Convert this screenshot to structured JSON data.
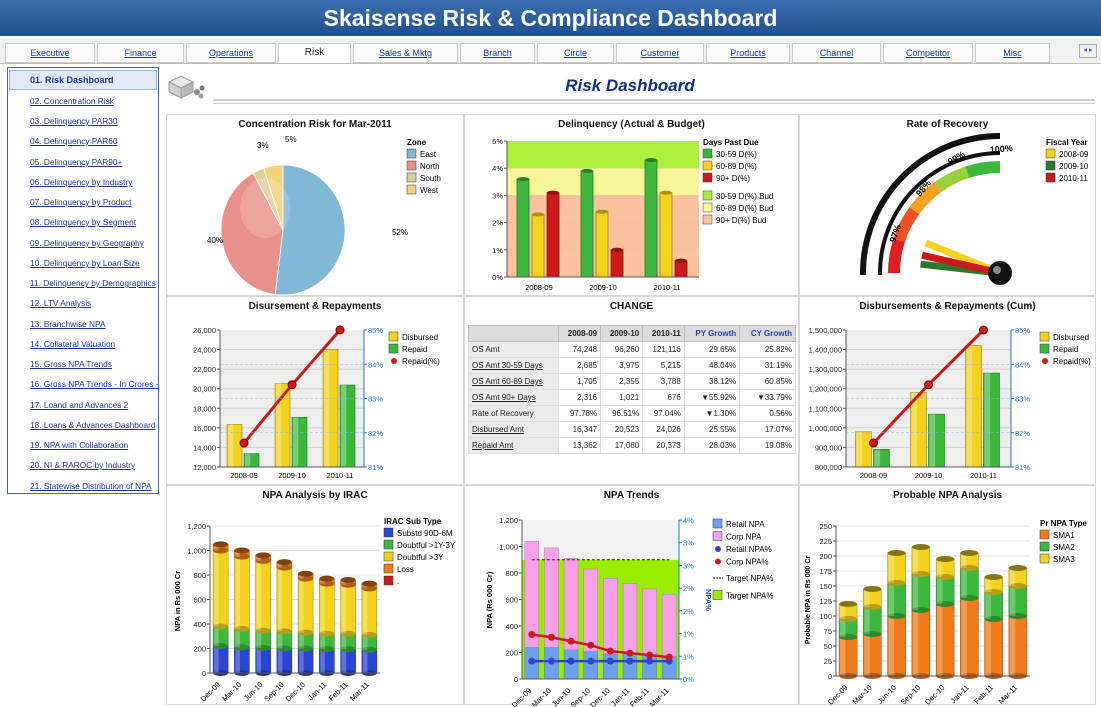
{
  "title": "Skaisense Risk & Compliance Dashboard",
  "tabs": [
    {
      "label": "Executive"
    },
    {
      "label": "Finance"
    },
    {
      "label": "Operations"
    },
    {
      "label": "Risk"
    },
    {
      "label": "Sales & Mktg"
    },
    {
      "label": "Branch"
    },
    {
      "label": "Circle"
    },
    {
      "label": "Customer"
    },
    {
      "label": "Products"
    },
    {
      "label": "Channel"
    },
    {
      "label": "Competitor"
    },
    {
      "label": "Misc"
    }
  ],
  "tab_nav_label": "◂ ▸",
  "sidebar": {
    "items": [
      {
        "label": "01. Risk Dashboard"
      },
      {
        "label": "02. Concentration Risk"
      },
      {
        "label": "03. Delinquency PAR30"
      },
      {
        "label": "04. Delinquency PAR60"
      },
      {
        "label": "05. Delinquency PAR90+"
      },
      {
        "label": "06. Delinquency by Industry"
      },
      {
        "label": "07. Delinquency by Product"
      },
      {
        "label": "08. Delinquency by Segment"
      },
      {
        "label": "09. Delinquency by Geography"
      },
      {
        "label": "10. Delinquency by Loan Size"
      },
      {
        "label": "11. Delinquency by Demographics"
      },
      {
        "label": "12. LTV Analysis"
      },
      {
        "label": "13. Branchwise NPA"
      },
      {
        "label": "14. Collateral Valuation"
      },
      {
        "label": "15. Gross NPA Trends"
      },
      {
        "label": "16. Gross NPA Trends - In Crores -"
      },
      {
        "label": "17. Loand and Advances 2"
      },
      {
        "label": "18. Loans & Advances Dashboard"
      },
      {
        "label": "19. NPA with Collaboration"
      },
      {
        "label": "20. NI & RAROC by Industry"
      },
      {
        "label": "21. Statewise Distribution of NPA"
      }
    ]
  },
  "page_title": "Risk Dashboard",
  "panels": {
    "concentration": {
      "title": "Concentration Risk for Mar-2011",
      "legend_title": "Zone"
    },
    "delinquency": {
      "title": "Delinquency (Actual & Budget)",
      "legend_title": "Days Past Due"
    },
    "recovery": {
      "title": "Rate of Recovery",
      "legend_title": "Fiscal Year"
    },
    "disbursement": {
      "title": "Disursement & Repayments"
    },
    "change": {
      "title": "CHANGE"
    },
    "disb_cum": {
      "title": "Disbursements & Repayments (Cum)"
    },
    "npa_irac": {
      "title": "NPA Analysis by IRAC",
      "legend_title": "IRAC Sub Type"
    },
    "npa_trends": {
      "title": "NPA Trends"
    },
    "probable_npa": {
      "title": "Probable NPA Analysis",
      "legend_title": "Pr NPA Type"
    }
  },
  "colors": {
    "title_bar": "#2a5fa8",
    "accent": "#1a33a8",
    "green": "#3cb83c",
    "yellow": "#f2d21c",
    "red": "#cc1a1a"
  },
  "change_table": {
    "headers": [
      "",
      "2008-09",
      "2009-10",
      "2010-11",
      "PY Growth",
      "CY Growth"
    ],
    "rows": [
      [
        "OS Amt",
        "74,248",
        "96,260",
        "121,116",
        "29.65%",
        "25.82%"
      ],
      [
        "OS Amt 30-59 Days",
        "2,685",
        "3,975",
        "5,215",
        "48.04%",
        "31.19%"
      ],
      [
        "OS Amt 60-89 Days",
        "1,705",
        "2,355",
        "3,788",
        "38.12%",
        "60.85%"
      ],
      [
        "OS Amt 90+ Days",
        "2,316",
        "1,021",
        "676",
        "▼55.92%",
        "▼33.79%"
      ],
      [
        "Rate of Recovery",
        "97.78%",
        "96.51%",
        "97.04%",
        "▼1.30%",
        "0.56%"
      ],
      [
        "Disbursed Amt",
        "16,347",
        "20,523",
        "24,026",
        "25.55%",
        "17.07%"
      ],
      [
        "Repaid Amt",
        "13,362",
        "17,080",
        "20,373",
        "28.03%",
        "19.08%"
      ]
    ]
  },
  "chart_data": [
    {
      "id": "concentration",
      "type": "pie",
      "title": "Concentration Risk for Mar-2011",
      "legend_title": "Zone",
      "categories": [
        "East",
        "North",
        "South",
        "West"
      ],
      "values": [
        52,
        40,
        3,
        5
      ],
      "value_labels": [
        "52%",
        "40%",
        "3%",
        "5%"
      ],
      "colors": [
        "#7fb9d6",
        "#e8908a",
        "#d9d098",
        "#f0d27a"
      ]
    },
    {
      "id": "delinquency",
      "type": "bar",
      "title": "Delinquency (Actual & Budget)",
      "legend_title": "Days Past Due",
      "categories": [
        "2008-09",
        "2009-10",
        "2010-11"
      ],
      "ylim": [
        0,
        5
      ],
      "unit": "%",
      "yticks": [
        "0%",
        "1%",
        "2%",
        "3%",
        "4%",
        "5%"
      ],
      "series": [
        {
          "name": "30-59 D(%)",
          "values": [
            3.6,
            3.9,
            4.3
          ],
          "color": "#3cb83c"
        },
        {
          "name": "60-89 D(%)",
          "values": [
            2.3,
            2.4,
            3.1
          ],
          "color": "#f2d21c"
        },
        {
          "name": "90+ D(%)",
          "values": [
            3.1,
            1.0,
            0.6
          ],
          "color": "#cc1a1a"
        }
      ],
      "budget_bands": [
        {
          "name": "30-59 D(%) Bud",
          "from": 4.0,
          "to": 5.0,
          "color": "#aef03a"
        },
        {
          "name": "60-89 D(%) Bud",
          "from": 3.0,
          "to": 4.0,
          "color": "#f7f59a"
        },
        {
          "name": "90+ D(%) Bud",
          "from": 0.0,
          "to": 3.0,
          "color": "#f9c29c"
        }
      ]
    },
    {
      "id": "recovery",
      "type": "gauge",
      "title": "Rate of Recovery",
      "legend_title": "Fiscal Year",
      "scale_labels": [
        "97%",
        "98%",
        "99%",
        "100%"
      ],
      "series": [
        {
          "name": "2008-09",
          "value": 97.78,
          "color": "#f2d21c"
        },
        {
          "name": "2009-10",
          "value": 96.51,
          "color": "#2a7a2a"
        },
        {
          "name": "2010-11",
          "value": 97.04,
          "color": "#cc1a1a"
        }
      ]
    },
    {
      "id": "disbursement",
      "type": "bar",
      "title": "Disursement & Repayments",
      "categories": [
        "2008-09",
        "2009-10",
        "2010-11"
      ],
      "ylim": [
        12000,
        26000
      ],
      "yticks": [
        "12,000",
        "14,000",
        "16,000",
        "18,000",
        "20,000",
        "22,000",
        "24,000",
        "26,000"
      ],
      "y2lim": [
        81,
        85
      ],
      "y2ticks": [
        "81%",
        "82%",
        "83%",
        "84%",
        "85%"
      ],
      "series": [
        {
          "name": "Disbursed",
          "values": [
            16347,
            20523,
            24026
          ],
          "color": "#f2d21c"
        },
        {
          "name": "Repaid",
          "values": [
            13362,
            17080,
            20373
          ],
          "color": "#3cb83c"
        },
        {
          "name": "Repaid(%)",
          "values": [
            81.7,
            83.4,
            85
          ],
          "color": "#cc1a1a",
          "axis": "y2",
          "type": "line"
        }
      ]
    },
    {
      "id": "disb_cum",
      "type": "bar",
      "title": "Disbursements & Repayments (Cum)",
      "categories": [
        "2008-09",
        "2009-10",
        "2010-11"
      ],
      "ylim": [
        800000,
        1500000
      ],
      "yticks": [
        "800,000",
        "900,000",
        "1,000,000",
        "1,100,000",
        "1,200,000",
        "1,300,000",
        "1,400,000",
        "1,500,000"
      ],
      "y2lim": [
        81,
        85
      ],
      "y2ticks": [
        "81%",
        "82%",
        "83%",
        "84%",
        "85%"
      ],
      "series": [
        {
          "name": "Disbursed",
          "values": [
            980000,
            1180000,
            1420000
          ],
          "color": "#f2d21c"
        },
        {
          "name": "Repaid",
          "values": [
            890000,
            1070000,
            1280000
          ],
          "color": "#3cb83c"
        },
        {
          "name": "Repaid(%)",
          "values": [
            81.7,
            83.4,
            85
          ],
          "color": "#cc1a1a",
          "axis": "y2",
          "type": "line"
        }
      ]
    },
    {
      "id": "npa_irac",
      "type": "bar",
      "title": "NPA Analysis by IRAC",
      "legend_title": "IRAC Sub Type",
      "stacked": true,
      "ylabel": "NPA in Rs 000 Cr",
      "ylim": [
        0,
        1200
      ],
      "yticks": [
        "0",
        "200",
        "400",
        "600",
        "800",
        "1,000",
        "1,200"
      ],
      "categories": [
        "Dec-09",
        "Mar-10",
        "Jun-10",
        "Sep-10",
        "Dec-10",
        "Jan-11",
        "Feb-11",
        "Mar-11"
      ],
      "series": [
        {
          "name": "Substd 90D-6M",
          "values": [
            220,
            210,
            205,
            200,
            200,
            195,
            195,
            190
          ],
          "color": "#2a44d4"
        },
        {
          "name": "Doubtful >1Y-3Y",
          "values": [
            160,
            150,
            140,
            140,
            130,
            125,
            125,
            120
          ],
          "color": "#3cb83c"
        },
        {
          "name": "Doubtful >3Y",
          "values": [
            620,
            590,
            570,
            520,
            440,
            410,
            400,
            380
          ],
          "color": "#f2d21c"
        },
        {
          "name": "Loss",
          "values": [
            50,
            50,
            45,
            45,
            40,
            40,
            40,
            40
          ],
          "color": "#f07a1a"
        },
        {
          "name": ".",
          "values": [
            0,
            0,
            0,
            0,
            0,
            0,
            0,
            0
          ],
          "color": "#cc1a1a"
        }
      ]
    },
    {
      "id": "npa_trends",
      "type": "bar",
      "title": "NPA Trends",
      "ylabel": "NPA (Rs 000 Cr)",
      "y2label": "NPA%",
      "ylim": [
        0,
        1200
      ],
      "yticks": [
        "0",
        "200",
        "400",
        "600",
        "800",
        "1,000",
        "1,200"
      ],
      "y2lim": [
        0,
        4
      ],
      "y2ticks": [
        "0%",
        "1%",
        "1%",
        "2%",
        "2%",
        "3%",
        "3%",
        "4%"
      ],
      "categories": [
        "Dec-09",
        "Mar-10",
        "Jun-10",
        "Sep-10",
        "Dec-10",
        "Jan-11",
        "Feb-11",
        "Mar-11"
      ],
      "series": [
        {
          "name": "Retail NPA",
          "values": [
            240,
            240,
            220,
            210,
            190,
            190,
            180,
            170
          ],
          "color": "#6ea0f0"
        },
        {
          "name": "Corp NPA",
          "values": [
            800,
            750,
            690,
            620,
            570,
            530,
            500,
            470
          ],
          "color": "#f5a0ea"
        },
        {
          "name": "Retail NPA%",
          "values": [
            0.45,
            0.45,
            0.45,
            0.45,
            0.45,
            0.45,
            0.45,
            0.45
          ],
          "color": "#3344cc",
          "type": "line"
        },
        {
          "name": "Corp NPA%",
          "values": [
            1.12,
            1.05,
            0.95,
            0.85,
            0.7,
            0.65,
            0.6,
            0.55
          ],
          "color": "#cc1a1a",
          "type": "line"
        },
        {
          "name": "Target NPA%",
          "values": [
            3,
            3,
            3,
            3,
            3,
            3,
            3,
            3
          ],
          "color": "#222222",
          "type": "line"
        },
        {
          "name": "Target NPA%",
          "values": [
            3,
            3,
            3,
            3,
            3,
            3,
            3,
            3
          ],
          "color": "#99ee00",
          "type": "area"
        }
      ]
    },
    {
      "id": "probable_npa",
      "type": "bar",
      "title": "Probable NPA Analysis",
      "legend_title": "Pr NPA Type",
      "stacked": true,
      "ylabel": "Probable NPA in Rs 000 Cr",
      "ylim": [
        0,
        250
      ],
      "yticks": [
        "0",
        "25",
        "50",
        "75",
        "100",
        "125",
        "150",
        "175",
        "200",
        "225",
        "250"
      ],
      "categories": [
        "Dec-09",
        "Mar-10",
        "Jun-10",
        "Sep-10",
        "Dec-10",
        "Jan-11",
        "Feb-11",
        "Mar-11"
      ],
      "series": [
        {
          "name": "SMA1",
          "values": [
            65,
            70,
            100,
            110,
            120,
            130,
            95,
            100
          ],
          "color": "#f07a1a"
        },
        {
          "name": "SMA2",
          "values": [
            30,
            45,
            55,
            60,
            45,
            50,
            45,
            50
          ],
          "color": "#3cb83c"
        },
        {
          "name": "SMA3",
          "values": [
            25,
            30,
            50,
            45,
            30,
            25,
            25,
            30
          ],
          "color": "#f2d21c"
        }
      ]
    }
  ]
}
